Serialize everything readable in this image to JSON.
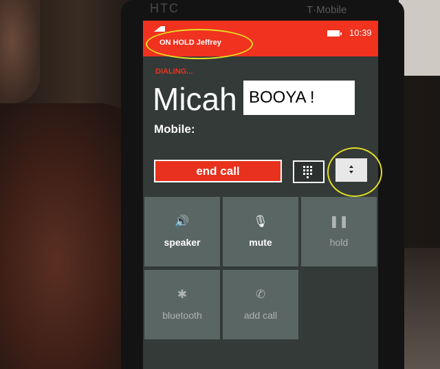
{
  "phone": {
    "brand_left": "HTC",
    "brand_right": "T·Mobile"
  },
  "status_bar": {
    "hold_label": "ON HOLD Jeffrey",
    "time": "10:39"
  },
  "call": {
    "state": "DIALING...",
    "name": "Micah",
    "number_type": "Mobile:"
  },
  "controls": {
    "end_call_label": "end call"
  },
  "tiles": [
    {
      "label": "speaker",
      "icon": "🔊"
    },
    {
      "label": "mute",
      "icon": "🎙"
    },
    {
      "label": "hold",
      "icon": "❚❚"
    },
    {
      "label": "bluetooth",
      "icon": "✱"
    },
    {
      "label": "add call",
      "icon": "✆"
    }
  ],
  "overlay": {
    "caption": "BOOYA !"
  },
  "colors": {
    "accent": "#f0321f",
    "tile": "#5a6664",
    "highlight": "#e4df22"
  }
}
